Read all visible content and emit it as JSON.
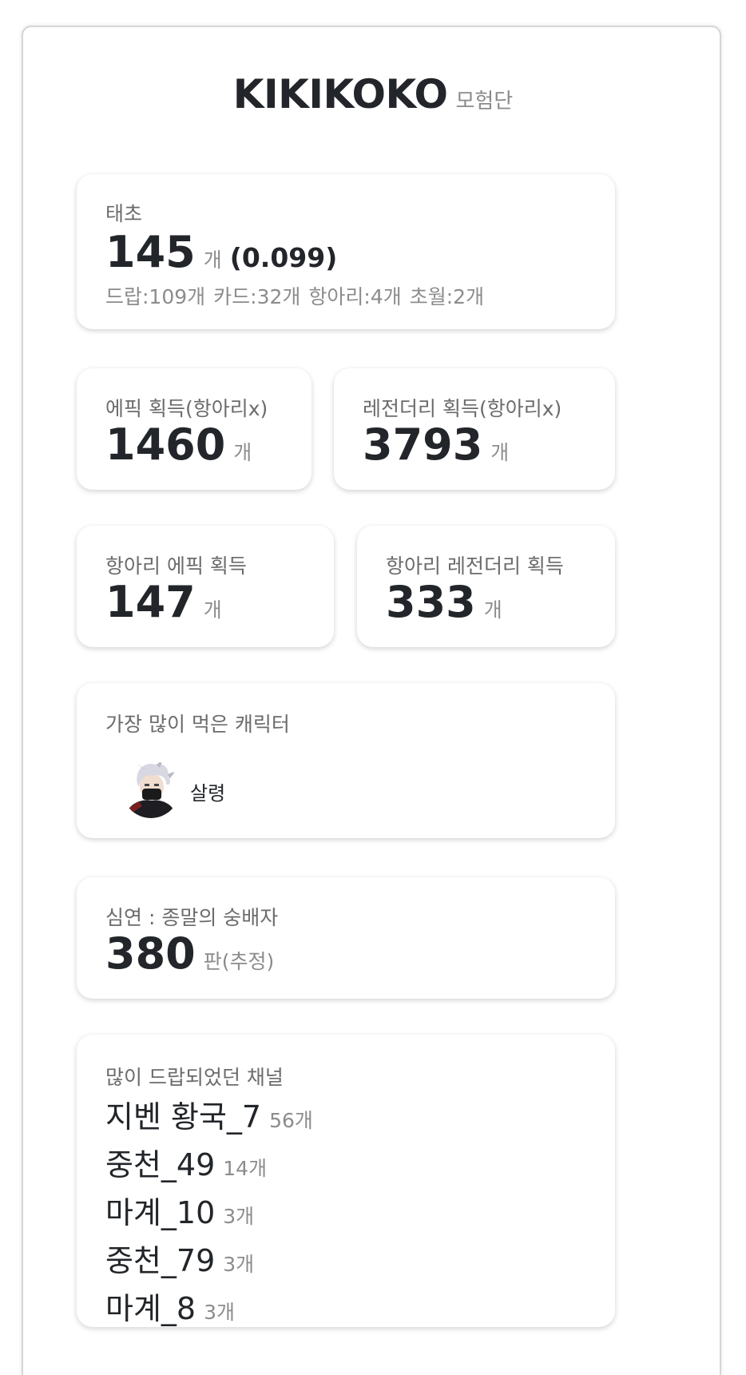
{
  "header": {
    "name": "KIKIKOKO",
    "subtitle": "모험단"
  },
  "taecho": {
    "label": "태초",
    "value": "145",
    "unit": "개",
    "ratio": "(0.099)",
    "details": [
      "드랍:109개",
      "카드:32개",
      "항아리:4개",
      "초월:2개"
    ]
  },
  "epic_no_jar": {
    "label": "에픽 획득(항아리x)",
    "value": "1460",
    "unit": "개"
  },
  "legendary_no_jar": {
    "label": "레전더리 획득(항아리x)",
    "value": "3793",
    "unit": "개"
  },
  "jar_epic": {
    "label": "항아리 에픽 획득",
    "value": "147",
    "unit": "개"
  },
  "jar_legendary": {
    "label": "항아리 레전더리 획득",
    "value": "333",
    "unit": "개"
  },
  "top_character": {
    "label": "가장 많이 먹은 캐릭터",
    "name": "살령"
  },
  "abyss": {
    "label": "심연 : 종말의 숭배자",
    "value": "380",
    "unit": "판(추정)"
  },
  "channels": {
    "label": "많이 드랍되었던 채널",
    "items": [
      {
        "name": "지벤 황국_7",
        "count": "56개"
      },
      {
        "name": "중천_49",
        "count": "14개"
      },
      {
        "name": "마계_10",
        "count": "3개"
      },
      {
        "name": "중천_79",
        "count": "3개"
      },
      {
        "name": "마계_8",
        "count": "3개"
      }
    ]
  }
}
